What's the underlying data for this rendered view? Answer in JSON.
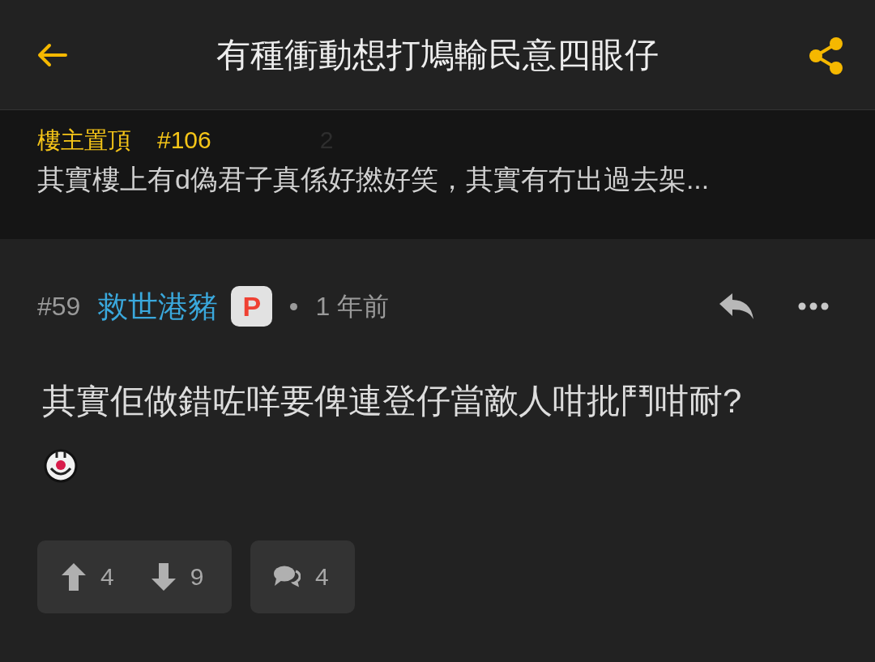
{
  "header": {
    "title": "有種衝動想打鳩輸民意四眼仔"
  },
  "pinned": {
    "label": "樓主置頂",
    "post_number": "#106",
    "text": "其實樓上有d偽君子真係好撚好笑，其實有冇出過去架...",
    "behind": {
      "comment_count": "2"
    }
  },
  "post": {
    "number": "#59",
    "author": "救世港豬",
    "badge": "P",
    "time": "1 年前",
    "body": "其實佢做錯咗咩要俾連登仔當敵人咁批鬥咁耐?",
    "upvotes": "4",
    "downvotes": "9",
    "comments": "4"
  }
}
